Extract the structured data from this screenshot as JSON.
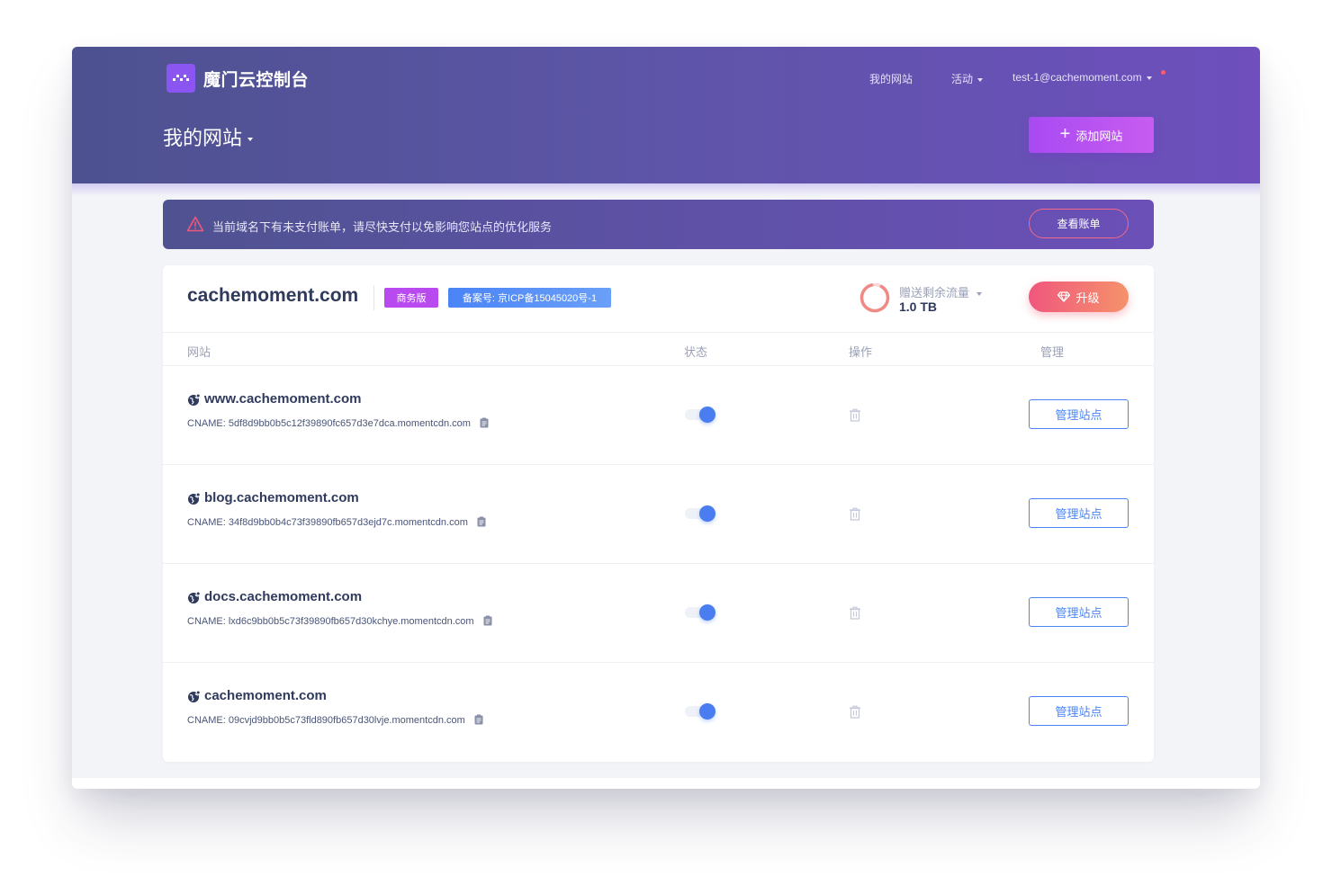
{
  "app": {
    "brand": "魔门云控制台",
    "nav": {
      "my_sites": "我的网站",
      "activities": "活动",
      "user_email": "test-1@cachemoment.com"
    },
    "page_title": "我的网站",
    "add_site_label": "添加网站"
  },
  "alert": {
    "text": "当前域名下有未支付账单，请尽快支付以免影响您站点的优化服务",
    "button": "查看账单"
  },
  "domain": {
    "name": "cachemoment.com",
    "plan_badge": "商务版",
    "icp_badge": "备案号: 京ICP备15045020号-1",
    "traffic_label": "赠送剩余流量",
    "traffic_value": "1.0 TB",
    "upgrade_label": "升级"
  },
  "table": {
    "headers": {
      "site": "网站",
      "status": "状态",
      "action": "操作",
      "manage": "管理"
    },
    "rows": [
      {
        "name": "www.cachemoment.com",
        "cname": "CNAME: 5df8d9bb0b5c12f39890fc657d3e7dca.momentcdn.com",
        "enabled": true,
        "manage_label": "管理站点"
      },
      {
        "name": "blog.cachemoment.com",
        "cname": "CNAME: 34f8d9bb0b4c73f39890fb657d3ejd7c.momentcdn.com",
        "enabled": true,
        "manage_label": "管理站点"
      },
      {
        "name": "docs.cachemoment.com",
        "cname": "CNAME: lxd6c9bb0b5c73f39890fb657d30kchye.momentcdn.com",
        "enabled": true,
        "manage_label": "管理站点"
      },
      {
        "name": "cachemoment.com",
        "cname": "CNAME: 09cvjd9bb0b5c73fld890fb657d30lvje.momentcdn.com",
        "enabled": true,
        "manage_label": "管理站点"
      }
    ]
  },
  "colors": {
    "header_start": "#4d5190",
    "header_end": "#6e4fbd",
    "accent_blue": "#4a84f6",
    "plan_purple": "#b94af0",
    "upgrade_pink": "#f0577e"
  },
  "icons": [
    "logo-icon",
    "caret-down-icon",
    "plus-icon",
    "warning-icon",
    "ring-icon",
    "diamond-icon",
    "globe-icon",
    "clipboard-icon",
    "trash-icon"
  ]
}
